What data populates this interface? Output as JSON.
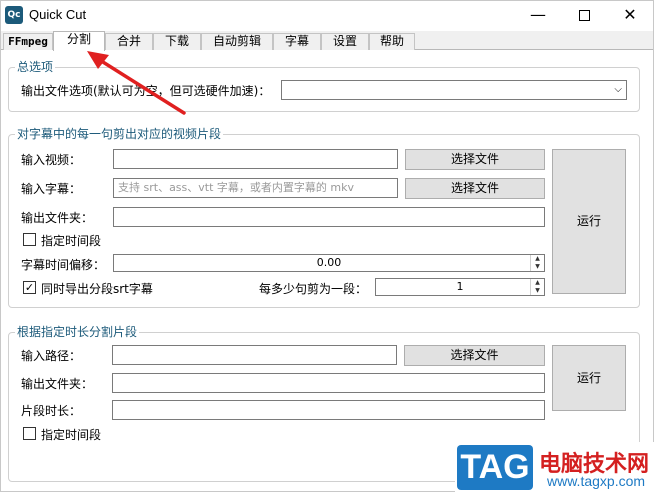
{
  "window": {
    "icon_text": "Qc",
    "title": "Quick Cut",
    "minimize_glyph": "—",
    "close_glyph": "✕"
  },
  "tabs": [
    {
      "label": "FFmpeg"
    },
    {
      "label": "分割"
    },
    {
      "label": "合并"
    },
    {
      "label": "下载"
    },
    {
      "label": "自动剪辑"
    },
    {
      "label": "字幕"
    },
    {
      "label": "设置"
    },
    {
      "label": "帮助"
    }
  ],
  "active_tab": "分割",
  "general": {
    "title": "总选项",
    "output_options_label": "输出文件选项(默认可为空，但可选硬件加速)：",
    "output_options_value": ""
  },
  "subtitle_split": {
    "title": "对字幕中的每一句剪出对应的视频片段",
    "input_video_label": "输入视频：",
    "input_video_value": "",
    "input_subtitle_label": "输入字幕：",
    "input_subtitle_placeholder": "支持 srt、ass、vtt 字幕，或者内置字幕的 mkv",
    "output_folder_label": "输出文件夹：",
    "output_folder_value": "",
    "choose_file_label_1": "选择文件",
    "choose_file_label_2": "选择文件",
    "specify_period_label": "指定时间段",
    "specify_period_checked": false,
    "time_offset_label": "字幕时间偏移：",
    "time_offset_value": "0.00",
    "export_srt_label": "同时导出分段srt字幕",
    "export_srt_checked": true,
    "sentences_per_segment_label": "每多少句剪为一段：",
    "sentences_per_segment_value": "1",
    "run_label": "运行"
  },
  "duration_split": {
    "title": "根据指定时长分割片段",
    "input_path_label": "输入路径：",
    "input_path_value": "",
    "choose_file_label": "选择文件",
    "output_folder_label": "输出文件夹：",
    "output_folder_value": "",
    "segment_length_label": "片段时长：",
    "segment_length_value": "",
    "specify_period_label": "指定时间段",
    "specify_period_checked": false,
    "run_label": "运行"
  },
  "watermark": {
    "badge": "TAG",
    "site_name": "电脑技术网",
    "url": "www.tagxp.com"
  },
  "colors": {
    "group_title": "#1c5a7a",
    "annotation_arrow": "#e02020",
    "watermark_blue": "#1e7ac4",
    "watermark_red": "#d42020"
  },
  "icons": {
    "dropdown": "chevron-down-icon",
    "spinner": "spinner-arrows-icon",
    "annotation": "red-arrow-annotation"
  }
}
